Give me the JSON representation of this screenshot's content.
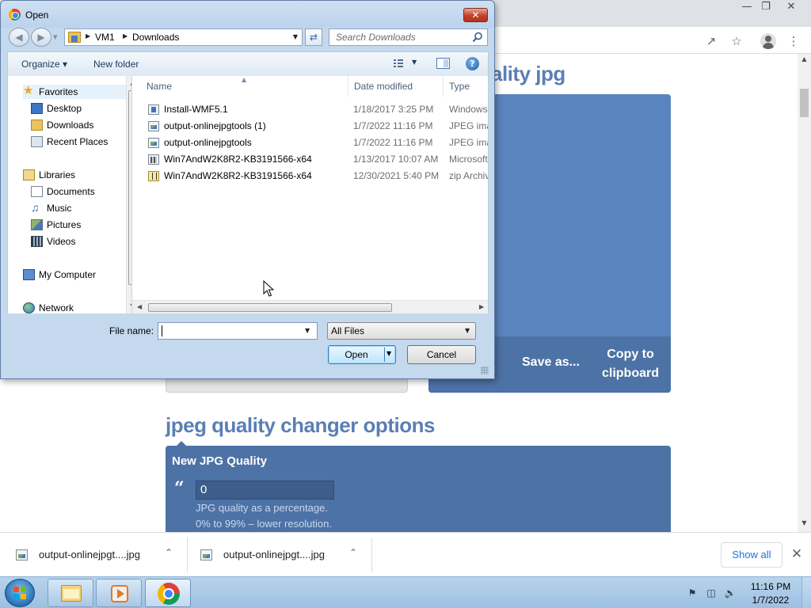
{
  "browser": {
    "heading_partial": "ality jpg",
    "output_buttons": {
      "save_as": "Save as...",
      "copy_to_clipboard": "Copy to clipboard"
    },
    "options_heading": "jpeg quality changer options",
    "options_panel": {
      "title": "New JPG Quality",
      "quality_value": "0",
      "help_line_1": "JPG quality as a percentage.",
      "help_line_2": "0% to 99% – lower resolution."
    },
    "accent_color": "#5b7fb5"
  },
  "downloads": {
    "items": [
      {
        "name": "output-onlinejpgt....jpg"
      },
      {
        "name": "output-onlinejpgt....jpg"
      }
    ],
    "show_all": "Show all"
  },
  "dialog": {
    "title": "Open",
    "breadcrumb": [
      "VM1",
      "Downloads"
    ],
    "search_placeholder": "Search Downloads",
    "toolbar": {
      "organize": "Organize",
      "new_folder": "New folder"
    },
    "nav_pane": {
      "favorites": "Favorites",
      "favorites_items": [
        "Desktop",
        "Downloads",
        "Recent Places"
      ],
      "libraries": "Libraries",
      "libraries_items": [
        "Documents",
        "Music",
        "Pictures",
        "Videos"
      ],
      "computer": "My Computer",
      "network": "Network"
    },
    "columns": {
      "name": "Name",
      "date_modified": "Date modified",
      "type": "Type"
    },
    "files": [
      {
        "name": "Install-WMF5.1",
        "date": "1/18/2017 3:25 PM",
        "type": "Windows",
        "icon": "installer-icon"
      },
      {
        "name": "output-onlinejpgtools (1)",
        "date": "1/7/2022 11:16 PM",
        "type": "JPEG imag",
        "icon": "image-file-icon"
      },
      {
        "name": "output-onlinejpgtools",
        "date": "1/7/2022 11:16 PM",
        "type": "JPEG imag",
        "icon": "image-file-icon"
      },
      {
        "name": "Win7AndW2K8R2-KB3191566-x64",
        "date": "1/13/2017 10:07 AM",
        "type": "Microsoft",
        "icon": "update-package-icon"
      },
      {
        "name": "Win7AndW2K8R2-KB3191566-x64",
        "date": "12/30/2021 5:40 PM",
        "type": "zip Archiv",
        "icon": "zip-archive-icon"
      }
    ],
    "file_name_label": "File name:",
    "file_name_value": "",
    "file_type_filter": "All Files",
    "open_button": "Open",
    "cancel_button": "Cancel"
  },
  "taskbar": {
    "clock_time": "11:16 PM",
    "clock_date": "1/7/2022"
  }
}
